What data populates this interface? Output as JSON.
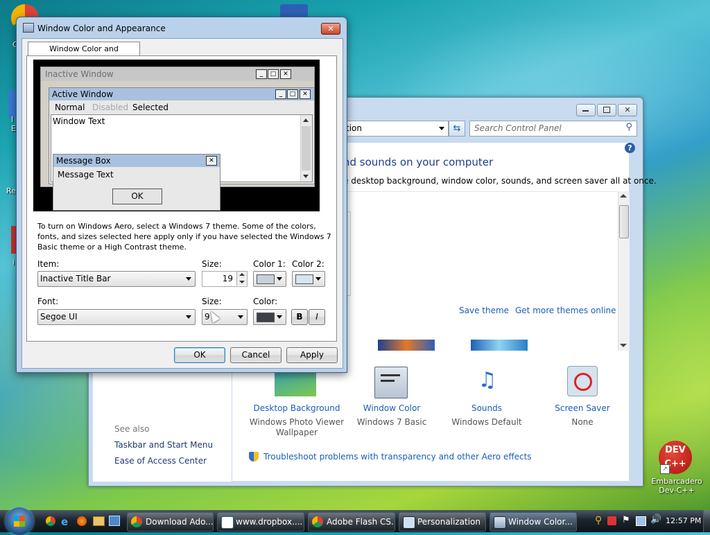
{
  "desktop": {
    "icon_labels": [
      "C",
      "I E",
      "Re",
      "i"
    ],
    "devcpp_label_line1": "Embarcadero",
    "devcpp_label_line2": "Dev-C++"
  },
  "personalization": {
    "address_partial": "tion",
    "search_placeholder": "Search Control Panel",
    "heading_partial": "nd sounds on your computer",
    "subheading_partial": "e desktop background, window color, sounds, and screen saver all at once.",
    "save_theme": "Save theme",
    "get_more_themes": "Get more themes online",
    "items": [
      {
        "title": "Desktop Background",
        "sub": "Windows Photo Viewer",
        "sub2": "Wallpaper"
      },
      {
        "title": "Window Color",
        "sub": "Windows 7 Basic",
        "sub2": ""
      },
      {
        "title": "Sounds",
        "sub": "Windows Default",
        "sub2": ""
      },
      {
        "title": "Screen Saver",
        "sub": "None",
        "sub2": ""
      }
    ],
    "see_also": "See also",
    "see_also_links": [
      "Taskbar and Start Menu",
      "Ease of Access Center"
    ],
    "troubleshoot": "Troubleshoot problems with transparency and other Aero effects"
  },
  "dialog": {
    "title": "Window Color and Appearance",
    "tab": "Window Color and Appearance",
    "preview": {
      "inactive_title": "Inactive Window",
      "active_title": "Active Window",
      "menu_normal": "Normal",
      "menu_disabled": "Disabled",
      "menu_selected": "Selected",
      "window_text": "Window Text",
      "msgbox_title": "Message Box",
      "msgbox_text": "Message Text",
      "msgbox_ok": "OK"
    },
    "info_text_1": "To turn on Windows Aero, select a Windows 7 theme.  Some of the colors,",
    "info_text_2": "fonts, and sizes selected here apply only if you have selected the Windows 7",
    "info_text_3": "Basic theme or a High Contrast theme.",
    "item_label": "Item:",
    "item_value": "Inactive Title Bar",
    "size_label": "Size:",
    "size_value": "19",
    "color1_label": "Color 1:",
    "color2_label": "Color 2:",
    "font_label": "Font:",
    "font_value": "Segoe UI",
    "font_size_label": "Size:",
    "font_size_value": "9",
    "font_color_label": "Color:",
    "bold_label": "B",
    "italic_label": "I",
    "ok": "OK",
    "cancel": "Cancel",
    "apply": "Apply",
    "colors": {
      "color1": "#c6d1dc",
      "color2": "#d7e4f2",
      "font_color": "#3c4148"
    }
  },
  "taskbar": {
    "buttons": [
      {
        "label": "Download Ado...",
        "icon": "chrome-icon"
      },
      {
        "label": "www.dropbox....",
        "icon": "window-icon"
      },
      {
        "label": "Adobe Flash CS...",
        "icon": "chrome-icon"
      },
      {
        "label": "Personalization",
        "icon": "monitor-icon"
      },
      {
        "label": "Window Color...",
        "icon": "window-color-icon"
      }
    ],
    "clock": "12:57 PM"
  }
}
